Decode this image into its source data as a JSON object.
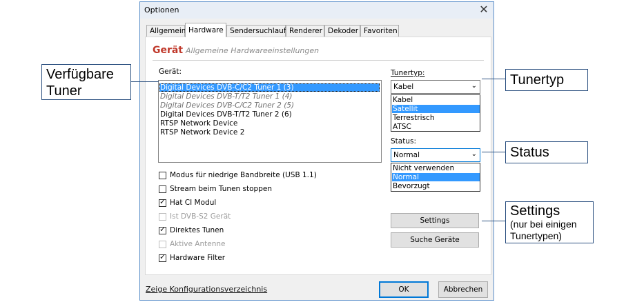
{
  "dialog": {
    "title": "Optionen",
    "close_symbol": "✕",
    "tabs": [
      "Allgemein",
      "Hardware",
      "Sendersuchlauf",
      "Renderer",
      "Dekoder",
      "Favoriten"
    ],
    "active_tab": "Hardware",
    "heading": "Gerät",
    "subheading": "Allgemeine Hardwareeinstellungen",
    "device_label": "Gerät:",
    "devices": [
      {
        "label": "Digital Devices DVB-C/C2 Tuner 1 (3)",
        "state": "selected"
      },
      {
        "label": "Digital Devices DVB-T/T2 Tuner 1 (4)",
        "state": "grey"
      },
      {
        "label": "Digital Devices DVB-C/C2 Tuner 2 (5)",
        "state": "grey"
      },
      {
        "label": "Digital Devices DVB-T/T2 Tuner 2 (6)",
        "state": "normal"
      },
      {
        "label": "RTSP Network Device",
        "state": "normal"
      },
      {
        "label": "RTSP Network Device 2",
        "state": "normal"
      }
    ],
    "checkboxes": [
      {
        "label": "Modus für niedrige Bandbreite (USB 1.1)",
        "checked": false,
        "enabled": true
      },
      {
        "label": "Stream beim Tunen stoppen",
        "checked": false,
        "enabled": true
      },
      {
        "label": "Hat CI Modul",
        "checked": true,
        "enabled": true
      },
      {
        "label": "Ist DVB-S2 Gerät",
        "checked": false,
        "enabled": false
      },
      {
        "label": "Direktes Tunen",
        "checked": true,
        "enabled": true
      },
      {
        "label": "Aktive Antenne",
        "checked": false,
        "enabled": false
      },
      {
        "label": "Hardware Filter",
        "checked": true,
        "enabled": true
      }
    ],
    "tunertype": {
      "label": "Tunertyp:",
      "value": "Kabel",
      "options": [
        "Kabel",
        "Satellit",
        "Terrestrisch",
        "ATSC"
      ],
      "highlighted": "Satellit"
    },
    "status": {
      "label": "Status:",
      "value": "Normal",
      "options": [
        "Nicht verwenden",
        "Normal",
        "Bevorzugt"
      ],
      "highlighted": "Normal"
    },
    "buttons": {
      "settings": "Settings",
      "search": "Suche Geräte",
      "ok": "OK",
      "cancel": "Abbrechen"
    },
    "config_link": "Zeige Konfigurationsverzeichnis",
    "chevron": "⌄"
  },
  "callouts": {
    "tuner": [
      "Verfügbare",
      "Tuner"
    ],
    "tunertype": "Tunertyp",
    "status": "Status",
    "settings_title": "Settings",
    "settings_note": [
      "(nur bei einigen",
      "Tunertypen)"
    ]
  },
  "colors": {
    "selection": "#3399ff",
    "heading": "#c0392b",
    "callout_border": "#2a4f7f",
    "dialog_border": "#5b8fc9"
  }
}
